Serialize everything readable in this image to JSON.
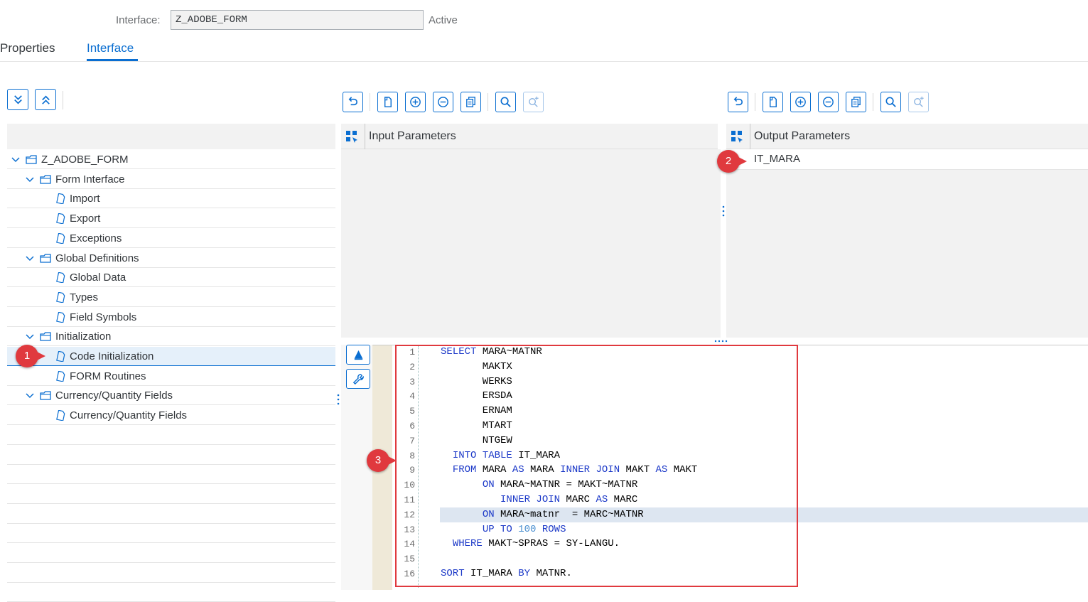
{
  "header": {
    "interface_label": "Interface:",
    "interface_value": "Z_ADOBE_FORM",
    "status": "Active"
  },
  "tabs": [
    {
      "label": "Properties",
      "active": false
    },
    {
      "label": "Interface",
      "active": true
    }
  ],
  "tree": {
    "toolbar_icons": [
      "expand-all-icon",
      "collapse-all-icon"
    ],
    "nodes": [
      {
        "label": "Z_ADOBE_FORM",
        "level": 0,
        "type": "folder",
        "expanded": true
      },
      {
        "label": "Form Interface",
        "level": 1,
        "type": "folder",
        "expanded": true
      },
      {
        "label": "Import",
        "level": 2,
        "type": "leaf"
      },
      {
        "label": "Export",
        "level": 2,
        "type": "leaf"
      },
      {
        "label": "Exceptions",
        "level": 2,
        "type": "leaf"
      },
      {
        "label": "Global Definitions",
        "level": 1,
        "type": "folder",
        "expanded": true
      },
      {
        "label": "Global Data",
        "level": 2,
        "type": "leaf"
      },
      {
        "label": "Types",
        "level": 2,
        "type": "leaf"
      },
      {
        "label": "Field Symbols",
        "level": 2,
        "type": "leaf"
      },
      {
        "label": "Initialization",
        "level": 1,
        "type": "folder",
        "expanded": true
      },
      {
        "label": "Code Initialization",
        "level": 2,
        "type": "leaf",
        "selected": true
      },
      {
        "label": "FORM Routines",
        "level": 2,
        "type": "leaf"
      },
      {
        "label": "Currency/Quantity Fields",
        "level": 1,
        "type": "folder",
        "expanded": true
      },
      {
        "label": "Currency/Quantity Fields",
        "level": 2,
        "type": "leaf"
      }
    ]
  },
  "input_panel": {
    "title": "Input Parameters",
    "toolbar_icons": [
      "undo-icon",
      "new-document-icon",
      "add-circle-icon",
      "remove-circle-icon",
      "copy-icon",
      "search-icon",
      "search-next-icon"
    ]
  },
  "output_panel": {
    "title": "Output Parameters",
    "toolbar_icons": [
      "undo-icon",
      "new-document-icon",
      "add-circle-icon",
      "remove-circle-icon",
      "copy-icon",
      "search-icon",
      "search-next-icon"
    ],
    "rows": [
      "IT_MARA"
    ]
  },
  "code": {
    "side_icons": [
      "pattern-icon",
      "wrench-icon"
    ],
    "lines": [
      {
        "n": "1",
        "parts": [
          [
            "kw",
            "SELECT"
          ],
          [
            "t",
            " MARA~MATNR"
          ]
        ]
      },
      {
        "n": "2",
        "parts": [
          [
            "t",
            "       MAKTX"
          ]
        ]
      },
      {
        "n": "3",
        "parts": [
          [
            "t",
            "       WERKS"
          ]
        ]
      },
      {
        "n": "4",
        "parts": [
          [
            "t",
            "       ERSDA"
          ]
        ]
      },
      {
        "n": "5",
        "parts": [
          [
            "t",
            "       ERNAM"
          ]
        ]
      },
      {
        "n": "6",
        "parts": [
          [
            "t",
            "       MTART"
          ]
        ]
      },
      {
        "n": "7",
        "parts": [
          [
            "t",
            "       NTGEW"
          ]
        ]
      },
      {
        "n": "8",
        "parts": [
          [
            "t",
            "  "
          ],
          [
            "kw",
            "INTO TABLE"
          ],
          [
            "t",
            " IT_MARA"
          ]
        ]
      },
      {
        "n": "9",
        "parts": [
          [
            "t",
            "  "
          ],
          [
            "kw",
            "FROM"
          ],
          [
            "t",
            " MARA "
          ],
          [
            "kw",
            "AS"
          ],
          [
            "t",
            " MARA "
          ],
          [
            "kw",
            "INNER JOIN"
          ],
          [
            "t",
            " MAKT "
          ],
          [
            "kw",
            "AS"
          ],
          [
            "t",
            " MAKT"
          ]
        ]
      },
      {
        "n": "10",
        "parts": [
          [
            "t",
            "       "
          ],
          [
            "kw",
            "ON"
          ],
          [
            "t",
            " MARA~MATNR = MAKT~MATNR"
          ]
        ]
      },
      {
        "n": "11",
        "parts": [
          [
            "t",
            "          "
          ],
          [
            "kw",
            "INNER JOIN"
          ],
          [
            "t",
            " MARC "
          ],
          [
            "kw",
            "AS"
          ],
          [
            "t",
            " MARC"
          ]
        ]
      },
      {
        "n": "12",
        "parts": [
          [
            "t",
            "       "
          ],
          [
            "kw",
            "ON"
          ],
          [
            "t",
            " MARA~matnr  = MARC~MATNR"
          ]
        ]
      },
      {
        "n": "13",
        "parts": [
          [
            "t",
            "       "
          ],
          [
            "kw",
            "UP TO"
          ],
          [
            "t",
            " "
          ],
          [
            "num",
            "100"
          ],
          [
            "t",
            " "
          ],
          [
            "kw",
            "ROWS"
          ]
        ]
      },
      {
        "n": "14",
        "parts": [
          [
            "t",
            "  "
          ],
          [
            "kw",
            "WHERE"
          ],
          [
            "t",
            " MAKT~SPRAS = SY-LANGU."
          ]
        ]
      },
      {
        "n": "15",
        "parts": []
      },
      {
        "n": "16",
        "parts": [
          [
            "kw",
            "SORT"
          ],
          [
            "t",
            " IT_MARA "
          ],
          [
            "kw",
            "BY"
          ],
          [
            "t",
            " MATNR."
          ]
        ]
      }
    ],
    "highlighted_line": "12"
  },
  "badges": [
    "1",
    "2",
    "3"
  ],
  "colors": {
    "accent": "#0a6ed1",
    "badge": "#e0393e",
    "keyword": "#1c39c8",
    "panel_bg": "#f2f2f2",
    "selected_row": "#e5f0fa"
  }
}
